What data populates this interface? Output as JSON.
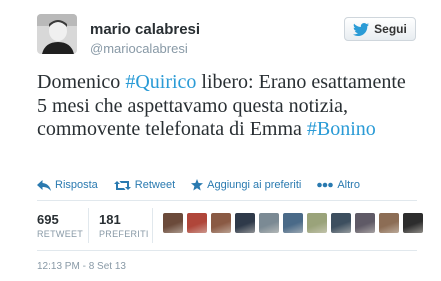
{
  "user": {
    "name": "mario calabresi",
    "handle": "@mariocalabresi"
  },
  "follow_button": {
    "label": "Segui"
  },
  "tweet": {
    "part1": "Domenico ",
    "hashtag1": "Quirico",
    "part2": " libero: Erano esattamente 5 mesi che aspettavamo questa notizia, commovente telefonata di Emma ",
    "hashtag2": "Bonino",
    "hash": "#"
  },
  "actions": {
    "reply": "Risposta",
    "retweet": "Retweet",
    "favorite": "Aggiungi ai preferiti",
    "more": "Altro"
  },
  "stats": {
    "retweets": {
      "count": "695",
      "label": "RETWEET"
    },
    "favorites": {
      "count": "181",
      "label": "PREFERITI"
    }
  },
  "faces": [
    {
      "color": "#6b4a3a"
    },
    {
      "color": "#b0463a"
    },
    {
      "color": "#8a5a44"
    },
    {
      "color": "#2f3a4a"
    },
    {
      "color": "#7b8a94"
    },
    {
      "color": "#4a6a88"
    },
    {
      "color": "#9aa37a"
    },
    {
      "color": "#3d4f5f"
    },
    {
      "color": "#5f5a66"
    },
    {
      "color": "#8c6d55"
    },
    {
      "color": "#2d2d2d"
    }
  ],
  "timestamp": "12:13 PM - 8 Set 13",
  "colors": {
    "accent": "#2a9bd6",
    "link": "#2a7ab0",
    "muted": "#8899a6"
  }
}
